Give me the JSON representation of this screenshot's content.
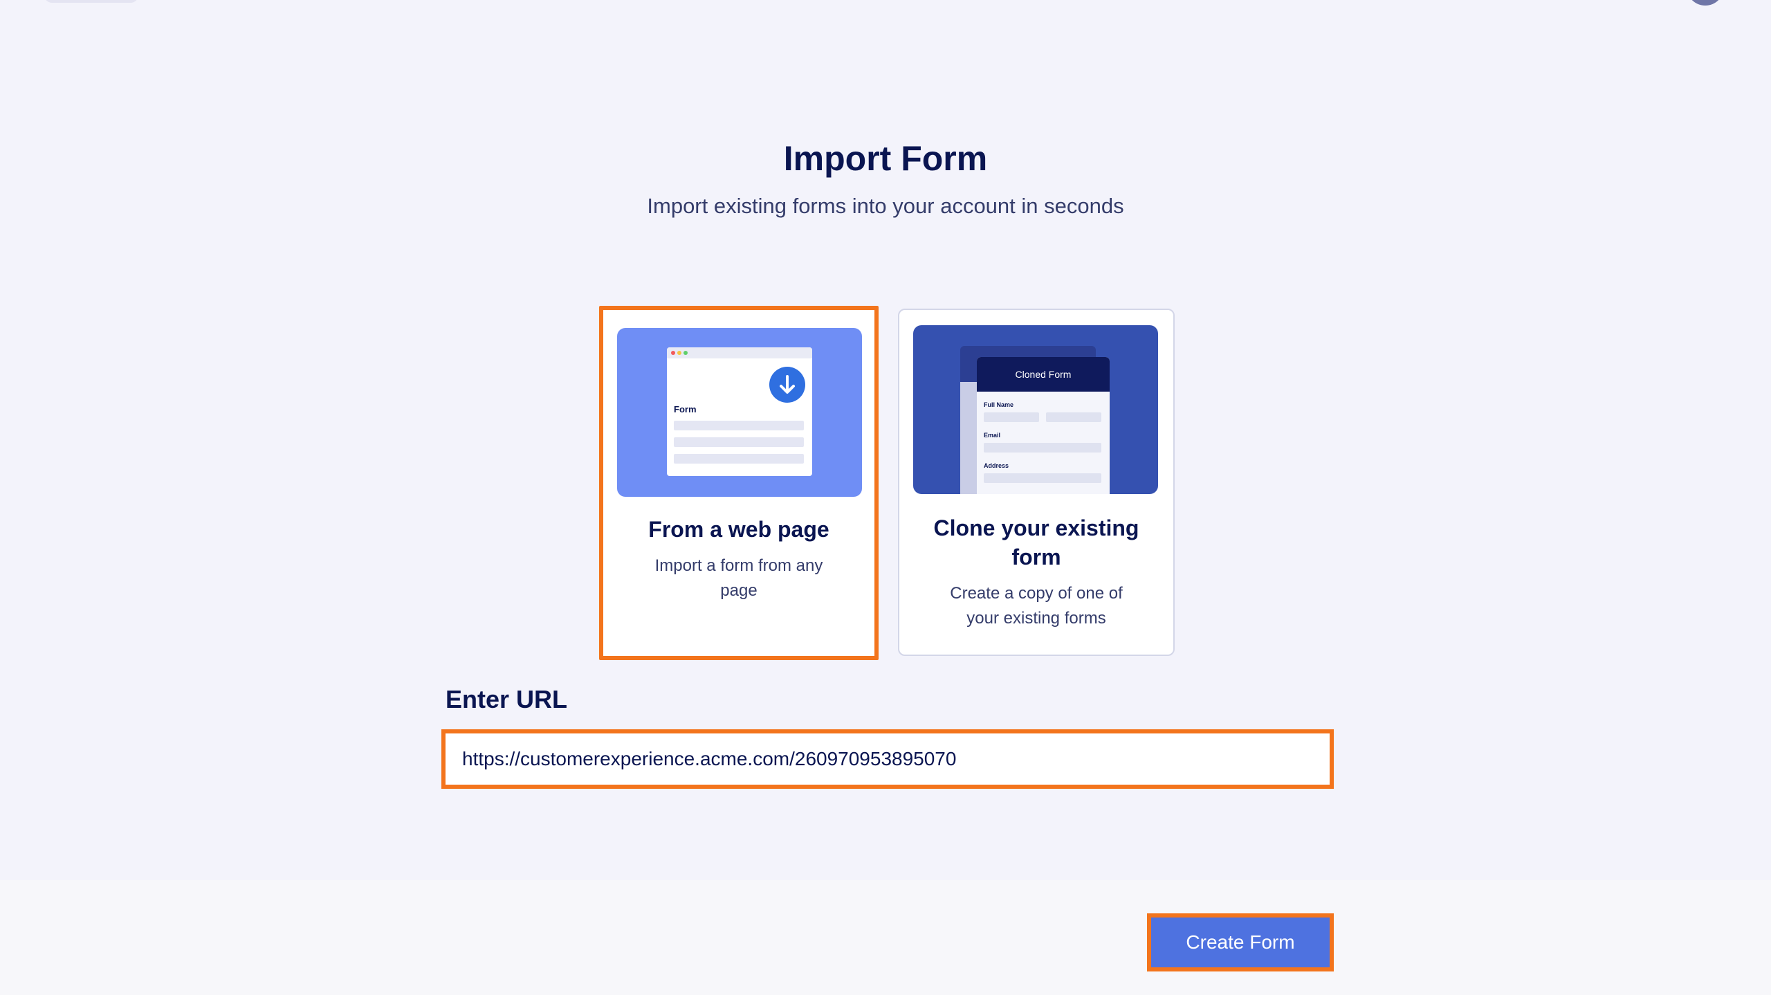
{
  "header": {
    "title": "Import Form",
    "subtitle": "Import existing forms into your account in seconds"
  },
  "options": {
    "web": {
      "title": "From a web page",
      "description": "Import a form from any page",
      "illustration_form_label": "Form",
      "selected": true
    },
    "clone": {
      "title": "Clone your existing form",
      "description": "Create a copy of one of your existing forms",
      "illustration_header": "Cloned Form",
      "illustration_fields": [
        "Full Name",
        "Email",
        "Address"
      ],
      "selected": false
    }
  },
  "url": {
    "label": "Enter URL",
    "value": "https://customerexperience.acme.com/260970953895070"
  },
  "actions": {
    "create_label": "Create Form"
  },
  "colors": {
    "accent": "#4e72e0",
    "highlight": "#f3741c",
    "navy": "#0a1551"
  }
}
